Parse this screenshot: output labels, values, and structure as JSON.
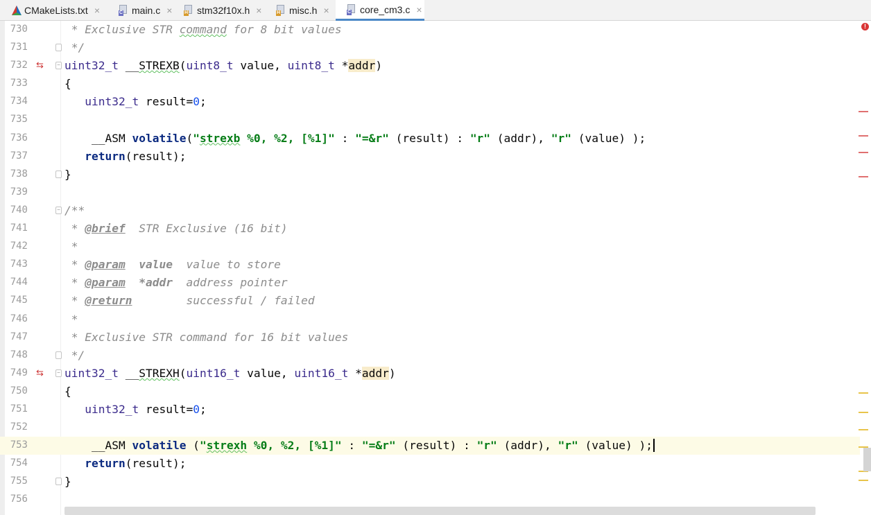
{
  "tabs": [
    {
      "label": "CMakeLists.txt",
      "icon": "cmake-icon",
      "active": false
    },
    {
      "label": "main.c",
      "icon": "c-file-icon",
      "active": false
    },
    {
      "label": "stm32f10x.h",
      "icon": "h-file-icon",
      "active": false
    },
    {
      "label": "misc.h",
      "icon": "h-file-icon",
      "active": false
    },
    {
      "label": "core_cm3.c",
      "icon": "c-file-icon",
      "active": true
    }
  ],
  "close_glyph": "×",
  "gutter_markers": {
    "implementation_icon": "⇆",
    "error_badge": "!"
  },
  "colors": {
    "accent": "#4a88c7",
    "error_marker": "#e07070",
    "warning_marker": "#e8c44a",
    "current_line": "#fdfbe6"
  },
  "editor": {
    "current_line": "753",
    "lines": [
      {
        "num": "730",
        "html": "<span class=\"cm\"> * Exclusive STR <span class=\"squig\">command</span> for 8 bit values</span>"
      },
      {
        "num": "731",
        "html": "<span class=\"cm\"> */</span>",
        "fold": "end"
      },
      {
        "num": "732",
        "html": "<span class=\"ty\">uint32_t</span> __<span class=\"squig\">STREXB</span>(<span class=\"ty\">uint8_t</span> value, <span class=\"ty\">uint8_t</span> *<span class=\"hl\">addr</span>)",
        "fold": "start",
        "impl": true
      },
      {
        "num": "733",
        "html": "{"
      },
      {
        "num": "734",
        "html": "   <span class=\"ty\">uint32_t</span> result=<span class=\"num\">0</span>;"
      },
      {
        "num": "735",
        "html": ""
      },
      {
        "num": "736",
        "html": "    __ASM <span class=\"kw\">volatile</span>(<span class=\"st\">\"<span class=\"squig\">strexb</span> %0, %2, [%1]\"</span> : <span class=\"st\">\"=&amp;r\"</span> (result) : <span class=\"st\">\"r\"</span> (addr), <span class=\"st\">\"r\"</span> (value) );"
      },
      {
        "num": "737",
        "html": "   <span class=\"kw\">return</span>(result);"
      },
      {
        "num": "738",
        "html": "}",
        "fold": "end"
      },
      {
        "num": "739",
        "html": ""
      },
      {
        "num": "740",
        "html": "<span class=\"cm\">/**</span>",
        "fold": "start"
      },
      {
        "num": "741",
        "html": "<span class=\"cm\"> * <span class=\"tag\">@brief</span>  STR Exclusive (16 bit)</span>"
      },
      {
        "num": "742",
        "html": "<span class=\"cm\"> *</span>"
      },
      {
        "num": "743",
        "html": "<span class=\"cm\"> * <span class=\"tag\">@param</span>  <span class=\"tagv\">value</span>  value to store</span>"
      },
      {
        "num": "744",
        "html": "<span class=\"cm\"> * <span class=\"tag\">@param</span>  <span class=\"tagv\">*addr</span>  address pointer</span>"
      },
      {
        "num": "745",
        "html": "<span class=\"cm\"> * <span class=\"tag\">@return</span>        successful / failed</span>"
      },
      {
        "num": "746",
        "html": "<span class=\"cm\"> *</span>"
      },
      {
        "num": "747",
        "html": "<span class=\"cm\"> * Exclusive STR command for 16 bit values</span>"
      },
      {
        "num": "748",
        "html": "<span class=\"cm\"> */</span>",
        "fold": "end"
      },
      {
        "num": "749",
        "html": "<span class=\"ty\">uint32_t</span> __<span class=\"squig\">STREXH</span>(<span class=\"ty\">uint16_t</span> value, <span class=\"ty\">uint16_t</span> *<span class=\"hl\">addr</span>)",
        "fold": "start",
        "impl": true
      },
      {
        "num": "750",
        "html": "{"
      },
      {
        "num": "751",
        "html": "   <span class=\"ty\">uint32_t</span> result=<span class=\"num\">0</span>;"
      },
      {
        "num": "752",
        "html": ""
      },
      {
        "num": "753",
        "html": "    __ASM <span class=\"kw\">volatile</span> (<span class=\"st\">\"<span class=\"squig\">strexh</span> %0, %2, [%1]\"</span> : <span class=\"st\">\"=&amp;r\"</span> (result) : <span class=\"st\">\"r\"</span> (addr), <span class=\"st\">\"r\"</span> (value) );<span class=\"caret\"></span>"
      },
      {
        "num": "754",
        "html": "   <span class=\"kw\">return</span>(result);"
      },
      {
        "num": "755",
        "html": "}",
        "fold": "end"
      },
      {
        "num": "756",
        "html": ""
      }
    ]
  }
}
